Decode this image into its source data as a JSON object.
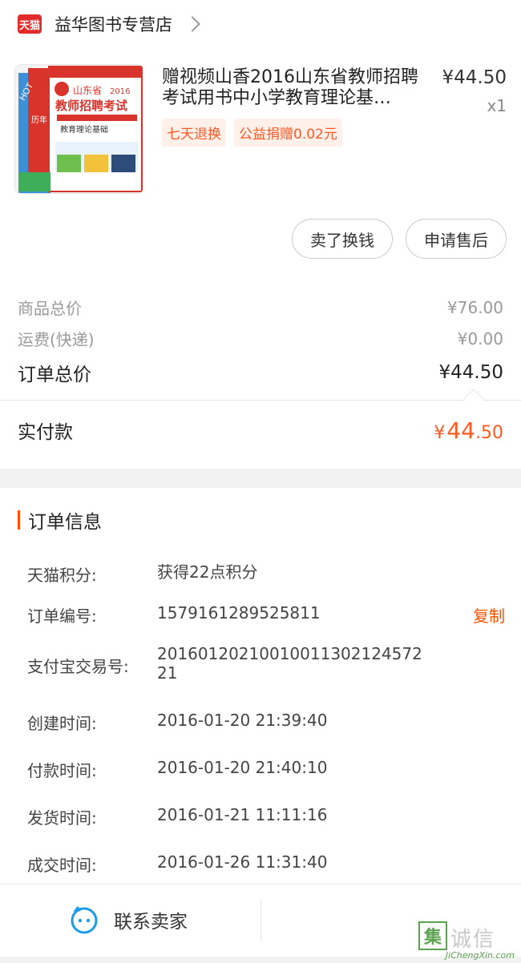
{
  "shop": {
    "badge": "天猫",
    "name": "益华图书专营店"
  },
  "product": {
    "title": "赠视频山香2016山东省教师招聘考试用书中小学教育理论基…",
    "price": "¥44.50",
    "qty": "x1",
    "tags": [
      "七天退换",
      "公益捐赠0.02元"
    ],
    "cover": {
      "hot": "HOT",
      "line1": "山东省",
      "year": "2016",
      "line2": "教师招聘考试",
      "line3": "教育理论基础",
      "side": "历年"
    }
  },
  "actions": {
    "sell": "卖了换钱",
    "after_sale": "申请售后"
  },
  "totals": {
    "goods_label": "商品总价",
    "goods_value": "¥76.00",
    "ship_label": "运费(快递)",
    "ship_value": "¥0.00",
    "order_label": "订单总价",
    "order_value": "¥44.50",
    "paid_label": "实付款",
    "paid_symbol": "¥",
    "paid_int": "44",
    "paid_dec": ".50"
  },
  "order_info": {
    "title": "订单信息",
    "copy": "复制",
    "rows": [
      {
        "k": "天猫积分:",
        "v": "获得22点积分"
      },
      {
        "k": "订单编号:",
        "v": "1579161289525811"
      },
      {
        "k": "支付宝交易号:",
        "v": "20160120210010011302124572 21"
      },
      {
        "k": "创建时间:",
        "v": "2016-01-20 21:39:40"
      },
      {
        "k": "付款时间:",
        "v": "2016-01-20 21:40:10"
      },
      {
        "k": "发货时间:",
        "v": "2016-01-21 11:11:16"
      },
      {
        "k": "成交时间:",
        "v": "2016-01-26 11:31:40"
      }
    ]
  },
  "bottom": {
    "contact": "联系卖家"
  },
  "watermark": {
    "tile": "集",
    "cn": "诚信",
    "en": "JiChengXin.com"
  },
  "colors": {
    "accent": "#ff5000",
    "tmall": "#e22c2c",
    "wm_green": "#5aa34f"
  }
}
